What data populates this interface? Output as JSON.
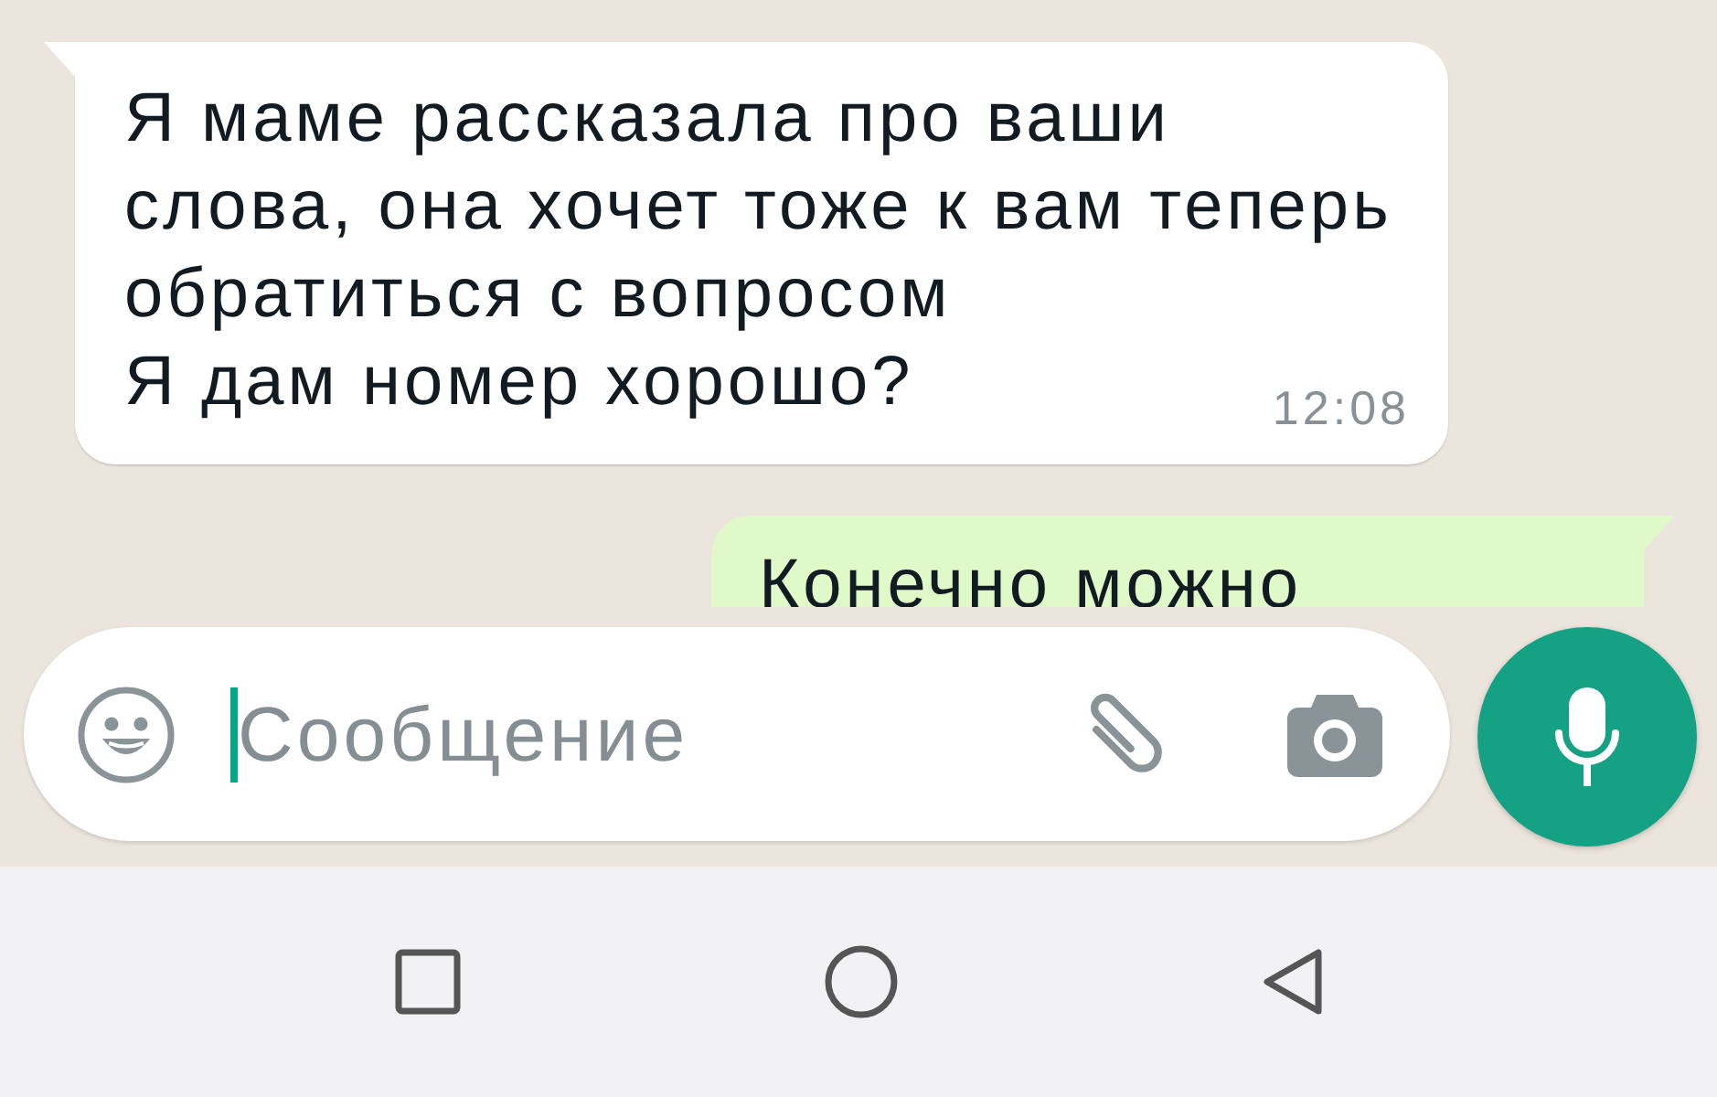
{
  "messages": [
    {
      "kind": "incoming",
      "paragraphs": [
        "Я маме рассказала про ваши слова, она хочет тоже к вам теперь обратиться с вопросом",
        "Я дам номер хорошо?"
      ],
      "time": "12:08"
    },
    {
      "kind": "outgoing",
      "paragraphs": [
        "Конечно можно"
      ]
    }
  ],
  "composer": {
    "placeholder": "Сообщение"
  }
}
